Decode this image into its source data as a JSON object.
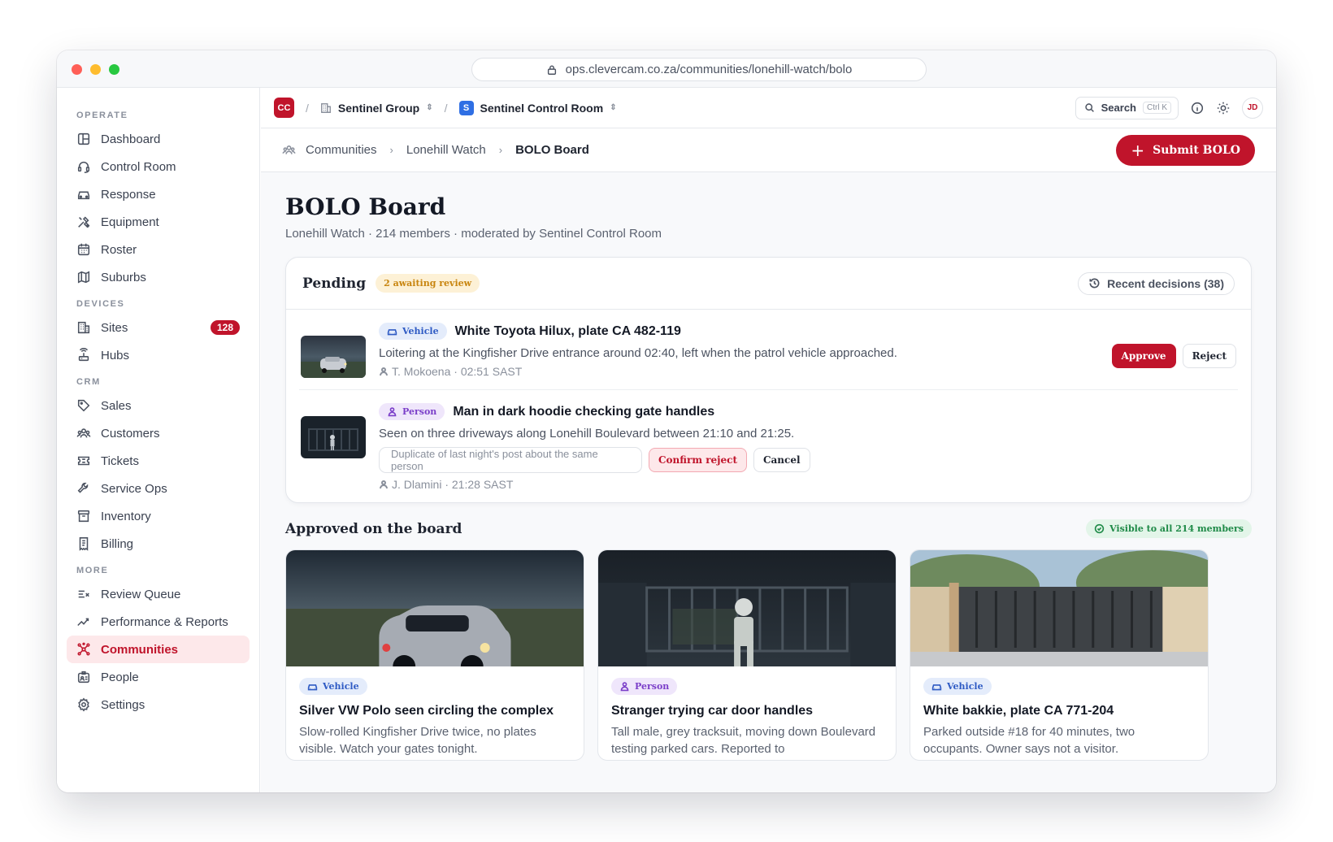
{
  "browser": {
    "url": "ops.clevercam.co.za/communities/lonehill-watch/bolo"
  },
  "sidebar": {
    "sections": [
      {
        "label": "OPERATE",
        "items": [
          {
            "label": "Dashboard",
            "icon": "layout-icon"
          },
          {
            "label": "Control Room",
            "icon": "headset-icon"
          },
          {
            "label": "Response",
            "icon": "car-icon"
          },
          {
            "label": "Equipment",
            "icon": "tools-icon"
          },
          {
            "label": "Roster",
            "icon": "calendar-icon"
          },
          {
            "label": "Suburbs",
            "icon": "map-icon"
          }
        ]
      },
      {
        "label": "DEVICES",
        "items": [
          {
            "label": "Sites",
            "icon": "building-icon",
            "badge": "128"
          },
          {
            "label": "Hubs",
            "icon": "hub-icon"
          }
        ]
      },
      {
        "label": "CRM",
        "items": [
          {
            "label": "Sales",
            "icon": "tag-icon"
          },
          {
            "label": "Customers",
            "icon": "users-icon"
          },
          {
            "label": "Tickets",
            "icon": "ticket-icon"
          },
          {
            "label": "Service Ops",
            "icon": "wrench-icon"
          },
          {
            "label": "Inventory",
            "icon": "archive-icon"
          },
          {
            "label": "Billing",
            "icon": "receipt-icon"
          }
        ]
      },
      {
        "label": "MORE",
        "items": [
          {
            "label": "Review Queue",
            "icon": "list-check-icon"
          },
          {
            "label": "Performance & Reports",
            "icon": "trend-icon"
          },
          {
            "label": "Communities",
            "icon": "network-icon",
            "active": true
          },
          {
            "label": "People",
            "icon": "id-card-icon"
          },
          {
            "label": "Settings",
            "icon": "gear-icon"
          }
        ]
      }
    ]
  },
  "topbar": {
    "org_initials": "CC",
    "group": "Sentinel Group",
    "room_initial": "S",
    "room": "Sentinel Control Room",
    "search_label": "Search",
    "search_shortcut": "Ctrl K",
    "user_initials": "JD"
  },
  "breadcrumb": {
    "items": [
      "Communities",
      "Lonehill Watch",
      "BOLO Board"
    ],
    "submit_label": "Submit BOLO"
  },
  "page": {
    "title": "BOLO Board",
    "subtitle": "Lonehill Watch · 214 members · moderated by Sentinel Control Room"
  },
  "pending": {
    "title": "Pending",
    "badge": "2 awaiting review",
    "recent_label": "Recent decisions (38)",
    "items": [
      {
        "tag": "Vehicle",
        "title": "White Toyota Hilux, plate CA 482-119",
        "desc": "Loitering at the Kingfisher Drive entrance around 02:40, left when the patrol vehicle approached.",
        "meta": "T. Mokoena · 02:51 SAST",
        "approve_label": "Approve",
        "reject_label": "Reject"
      },
      {
        "tag": "Person",
        "title": "Man in dark hoodie checking gate handles",
        "desc": "Seen on three driveways along Lonehill Boulevard between 21:10 and 21:25.",
        "reason_value": "Duplicate of last night's post about the same person",
        "confirm_label": "Confirm reject",
        "cancel_label": "Cancel",
        "meta": "J. Dlamini · 21:28 SAST"
      }
    ]
  },
  "approved": {
    "title": "Approved on the board",
    "visible_label": "Visible to all 214 members",
    "cards": [
      {
        "tag": "Vehicle",
        "title": "Silver VW Polo seen circling the complex",
        "desc": "Slow-rolled Kingfisher Drive twice, no plates visible. Watch your gates tonight."
      },
      {
        "tag": "Person",
        "title": "Stranger trying car door handles",
        "desc": "Tall male, grey tracksuit, moving down Boulevard testing parked cars. Reported to"
      },
      {
        "tag": "Vehicle",
        "title": "White bakkie, plate CA 771-204",
        "desc": "Parked outside #18 for 40 minutes, two occupants. Owner says not a visitor."
      }
    ]
  },
  "colors": {
    "accent": "#c0142b",
    "vehicle": "#2f5bc4",
    "person": "#7b3fc9",
    "success": "#1f8a48",
    "warning": "#c8850f"
  }
}
